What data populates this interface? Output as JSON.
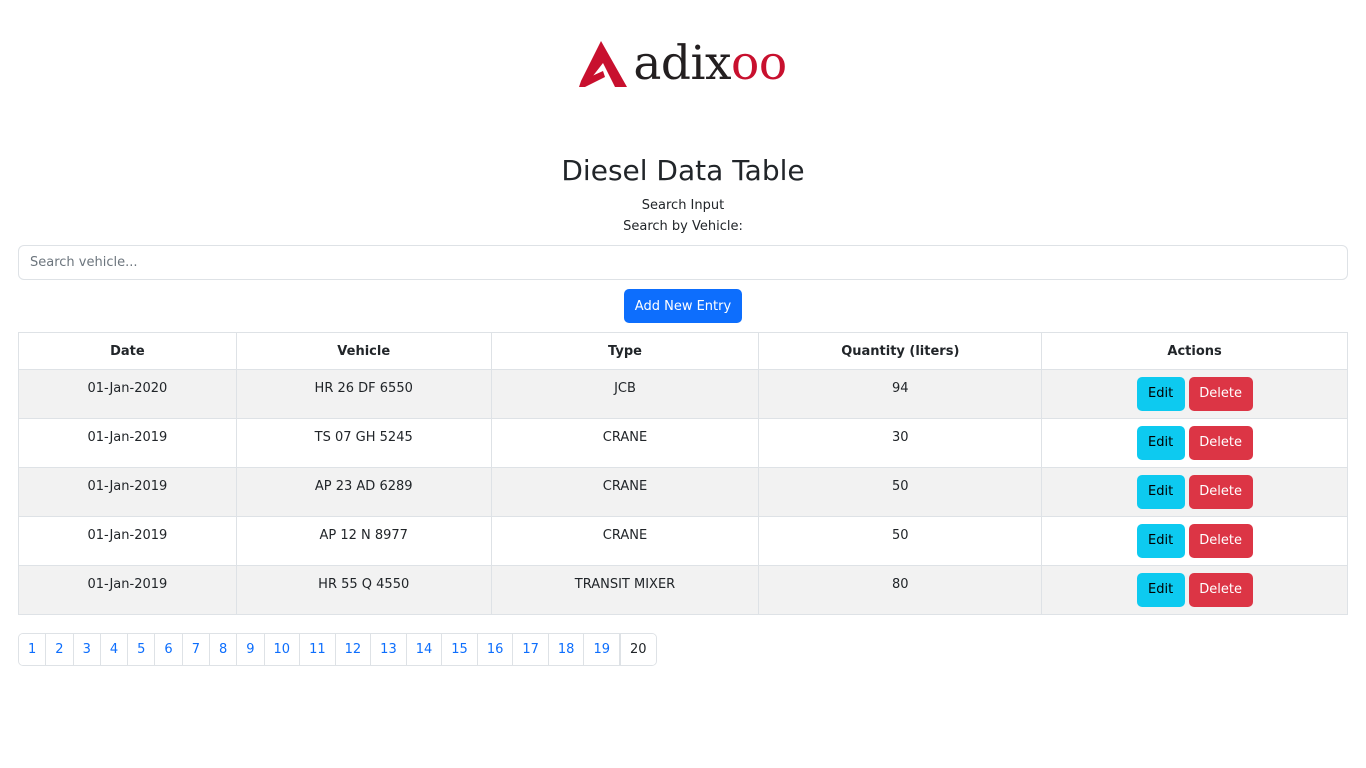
{
  "brand": {
    "logo_text_main": "adix",
    "logo_text_accent": "oo",
    "accent_color": "#c8102e"
  },
  "page": {
    "title": "Diesel Data Table",
    "search_caption": "Search Input",
    "search_label": "Search by Vehicle:",
    "search_placeholder": "Search vehicle...",
    "search_value": "",
    "add_button_label": "Add New Entry"
  },
  "table": {
    "headers": {
      "date": "Date",
      "vehicle": "Vehicle",
      "type": "Type",
      "quantity": "Quantity (liters)",
      "actions": "Actions"
    },
    "edit_label": "Edit",
    "delete_label": "Delete",
    "rows": [
      {
        "date": "01-Jan-2020",
        "vehicle": "HR 26 DF 6550",
        "type": "JCB",
        "quantity": "94"
      },
      {
        "date": "01-Jan-2019",
        "vehicle": "TS 07 GH 5245",
        "type": "CRANE",
        "quantity": "30"
      },
      {
        "date": "01-Jan-2019",
        "vehicle": "AP 23 AD 6289",
        "type": "CRANE",
        "quantity": "50"
      },
      {
        "date": "01-Jan-2019",
        "vehicle": "AP 12 N 8977",
        "type": "CRANE",
        "quantity": "50"
      },
      {
        "date": "01-Jan-2019",
        "vehicle": "HR 55 Q 4550",
        "type": "TRANSIT MIXER",
        "quantity": "80"
      }
    ]
  },
  "pagination": {
    "pages": [
      "1",
      "2",
      "3",
      "4",
      "5",
      "6",
      "7",
      "8",
      "9",
      "10",
      "11",
      "12",
      "13",
      "14",
      "15",
      "16",
      "17",
      "18",
      "19",
      "20"
    ],
    "active": "20"
  },
  "colors": {
    "primary": "#0d6efd",
    "info": "#0dcaf0",
    "danger": "#dc3545"
  }
}
